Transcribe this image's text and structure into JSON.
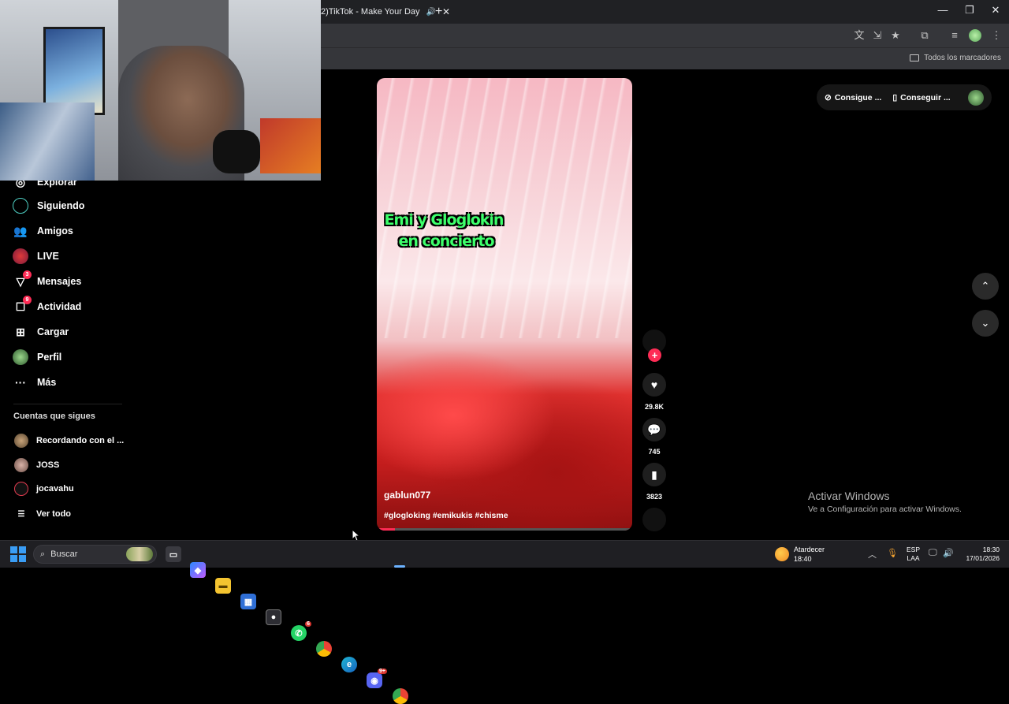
{
  "browser": {
    "tab_title": "2)TikTok - Make Your Day",
    "tab_close": "✕",
    "new_tab": "+",
    "window_minimize": "—",
    "window_maximize": "❐",
    "window_close": "✕",
    "bookmarks_all": "Todos los marcadores"
  },
  "sidebar": {
    "items": [
      {
        "label": "Explorar",
        "icon": "compass-icon"
      },
      {
        "label": "Siguiendo",
        "icon": "following-icon"
      },
      {
        "label": "Amigos",
        "icon": "friends-icon"
      },
      {
        "label": "LIVE",
        "icon": "live-icon"
      },
      {
        "label": "Mensajes",
        "icon": "messages-icon",
        "badge": "3"
      },
      {
        "label": "Actividad",
        "icon": "activity-icon",
        "badge": "9"
      },
      {
        "label": "Cargar",
        "icon": "upload-icon"
      },
      {
        "label": "Perfil",
        "icon": "profile-icon"
      },
      {
        "label": "Más",
        "icon": "more-icon"
      }
    ],
    "following_heading": "Cuentas que sigues",
    "following": [
      {
        "name": "Recordando con el ..."
      },
      {
        "name": "JOSS"
      },
      {
        "name": "jocavahu"
      }
    ],
    "see_all": "Ver todo"
  },
  "top_actions": {
    "button1": "Consigue ...",
    "button2": "Conseguir ..."
  },
  "video": {
    "overlay_line1": "Emi y Gloglokin",
    "overlay_line2": "en concierto",
    "username": "gablun077",
    "hashtags": "#glogloking #emikukis #chisme",
    "progress": 0.07
  },
  "actions": {
    "likes": "29.8K",
    "comments": "745",
    "saves": "3823"
  },
  "watermark": {
    "title": "Activar Windows",
    "subtitle": "Ve a Configuración para activar Windows."
  },
  "taskbar": {
    "search_placeholder": "Buscar",
    "whatsapp_badge": "6",
    "discord_badge": "9+",
    "weather_label": "Atardecer",
    "weather_time": "18:40",
    "lang_1": "ESP",
    "lang_2": "LAA",
    "time": "18:30",
    "date": "17/01/2026"
  },
  "colors": {
    "tiktok_red": "#fe2c55",
    "overlay_green": "#3dff6b",
    "background": "#000000"
  }
}
